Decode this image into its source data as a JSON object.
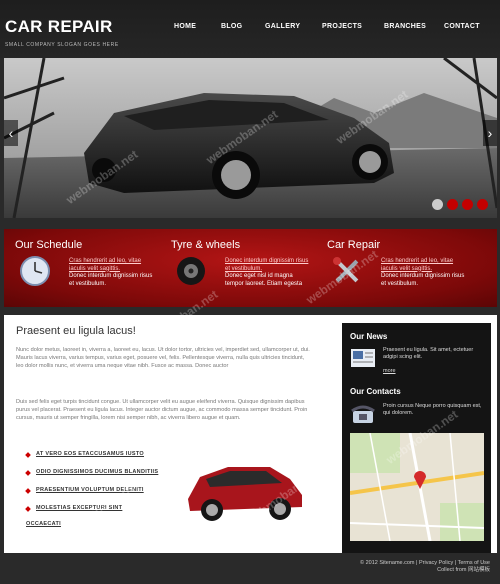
{
  "header": {
    "logo": "CAR REPAIR",
    "slogan": "SMALL COMPANY SLOGAN GOES HERE",
    "nav": [
      "HOME",
      "BLOG",
      "GALLERY",
      "PROJECTS",
      "BRANCHES",
      "CONTACT"
    ]
  },
  "slider": {
    "prev": "‹",
    "next": "›"
  },
  "features": [
    {
      "title": "Our Schedule",
      "link": "Cras hendrerit ad leo, vitae iaculis velit sagittis.",
      "text": "Donec interdum dignissim risus et vestibulum.",
      "icon": "clock-icon"
    },
    {
      "title": "Tyre & wheels",
      "link": "Donec interdum dignissim risus et vestibulum.",
      "text": "Donec eget nisl id magna tempor laoreet. Etiam egesta",
      "icon": "tyre-icon"
    },
    {
      "title": "Car Repair",
      "link": "Cras hendrerit ad leo, vitae iaculis velit sagittis.",
      "text": "Donec interdum dignissim risus et vestibulum.",
      "icon": "tools-icon"
    }
  ],
  "content": {
    "heading": "Praesent eu ligula lacus!",
    "para1": "Nunc dolor metus, laoreet in, viverra a, laoreet eu, lacus. Ut dolor tortor, ultricies vel, imperdiet sed, ullamcorper ut, dui. Mauris lacus viverra, varius tempus, varius eget, posuere vel, felis. Pellentesque viverra, nulla quis ultricies tincidunt, leo dolor mollis nunc, et viverra uma neque vitae nibh. Fusce ac massa. Donec auctor",
    "para2": "Duis sed felis eget turpis tincidunt congue. Ut ullamcorper velit eu augue eleifend viverra. Quisque dignissim dapibus purus vel placerat. Praesent eu ligula lacus. Integer auctor dictum augue, ac commodo massa semper tincidunt. Proin cursus, mauris ut semper fringilla, lorem nisi semper nibh, ac viverra libero augue et quam.",
    "links": [
      "AT VERO EOS ETACCUSAMUS IUSTO",
      "ODIO DIGNISSIMOS DUCIMUS BLANDITIIS",
      "PRAESENTIUM VOLUPTUM DELENITI",
      "MOLESTIAS EXCEPTURI SINT",
      "OCCAECATI"
    ]
  },
  "sidebar": {
    "news_title": "Our News",
    "news_text": "Praesent eu ligula. Sit amet, ectetuer adgipi scing elit.",
    "news_more": "more",
    "contacts_title": "Our Contacts",
    "contacts_text": "Proin cursus Neque porro quisquam est, qui dolorem."
  },
  "footer": {
    "copyright": "© 2012 Sitename.com | Privacy Policy | Terms of Use",
    "credit": "Collect from 网站模板"
  },
  "colors": {
    "accent_red": "#a60e0e",
    "dot_active": "#cccccc",
    "dot_red": "#c40000"
  }
}
